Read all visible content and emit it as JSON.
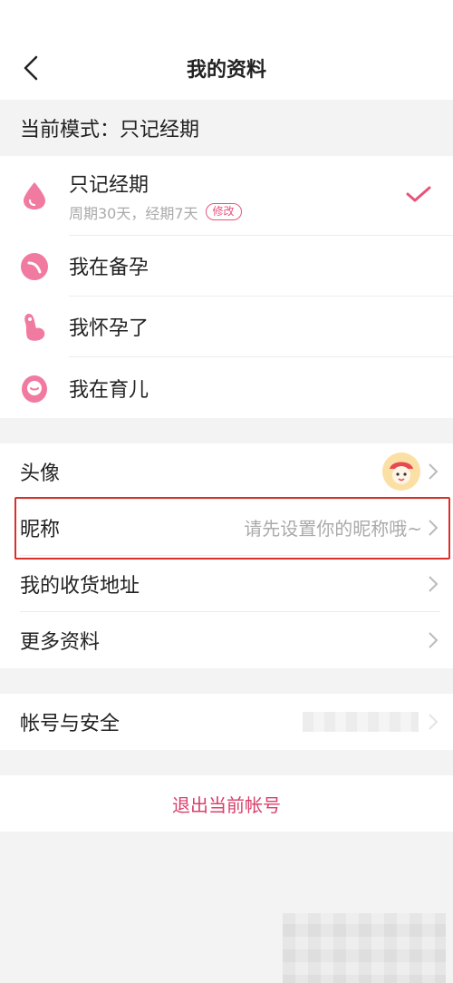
{
  "header": {
    "title": "我的资料"
  },
  "mode": {
    "current_label": "当前模式：只记经期"
  },
  "modes": [
    {
      "label": "只记经期",
      "sub": "周期30天，经期7天",
      "badge": "修改",
      "selected": true,
      "icon": "drop-icon"
    },
    {
      "label": "我在备孕",
      "icon": "egg-icon"
    },
    {
      "label": "我怀孕了",
      "icon": "pregnant-icon"
    },
    {
      "label": "我在育儿",
      "icon": "baby-icon"
    }
  ],
  "profile": {
    "avatar_label": "头像",
    "nickname_label": "昵称",
    "nickname_placeholder": "请先设置你的昵称哦~",
    "address_label": "我的收货地址",
    "more_label": "更多资料"
  },
  "account": {
    "security_label": "帐号与安全"
  },
  "logout": {
    "label": "退出当前帐号"
  },
  "colors": {
    "accent": "#e8537a",
    "highlight_box": "#d9302c"
  }
}
